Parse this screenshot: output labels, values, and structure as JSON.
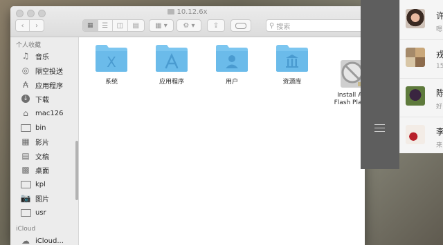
{
  "window": {
    "title": "10.12.6x",
    "search_placeholder": "搜索"
  },
  "sidebar": {
    "favorites_header": "个人收藏",
    "items": [
      {
        "label": "音乐",
        "icon": "music-icon"
      },
      {
        "label": "隔空投送",
        "icon": "airdrop-icon"
      },
      {
        "label": "应用程序",
        "icon": "applications-icon"
      },
      {
        "label": "下载",
        "icon": "download-icon"
      },
      {
        "label": "mac126",
        "icon": "home-icon"
      },
      {
        "label": "bin",
        "icon": "folder-icon"
      },
      {
        "label": "影片",
        "icon": "movies-icon"
      },
      {
        "label": "文稿",
        "icon": "documents-icon"
      },
      {
        "label": "桌面",
        "icon": "desktop-icon"
      },
      {
        "label": "kpl",
        "icon": "folder-icon"
      },
      {
        "label": "图片",
        "icon": "pictures-icon"
      },
      {
        "label": "usr",
        "icon": "folder-icon"
      }
    ],
    "icloud_header": "iCloud",
    "icloud_items": [
      {
        "label": "iCloud...",
        "icon": "cloud-icon"
      }
    ]
  },
  "content": {
    "items": [
      {
        "label": "系统",
        "icon": "system-folder-icon"
      },
      {
        "label": "应用程序",
        "icon": "applications-folder-icon"
      },
      {
        "label": "用户",
        "icon": "users-folder-icon"
      },
      {
        "label": "资源库",
        "icon": "library-folder-icon"
      },
      {
        "label": "Install Ad\nFlash Playe",
        "icon": "blocked-installer-icon"
      }
    ]
  },
  "chats": [
    {
      "name": "许",
      "snippet": "嗯"
    },
    {
      "name": "戎",
      "snippet": "15"
    },
    {
      "name": "陈",
      "snippet": "好"
    },
    {
      "name": "李",
      "snippet": "来"
    }
  ],
  "colors": {
    "folder_blue": "#79c3ee",
    "sidebar_bg": "#ececec",
    "toolbar_bg": "#e3e3e3"
  }
}
